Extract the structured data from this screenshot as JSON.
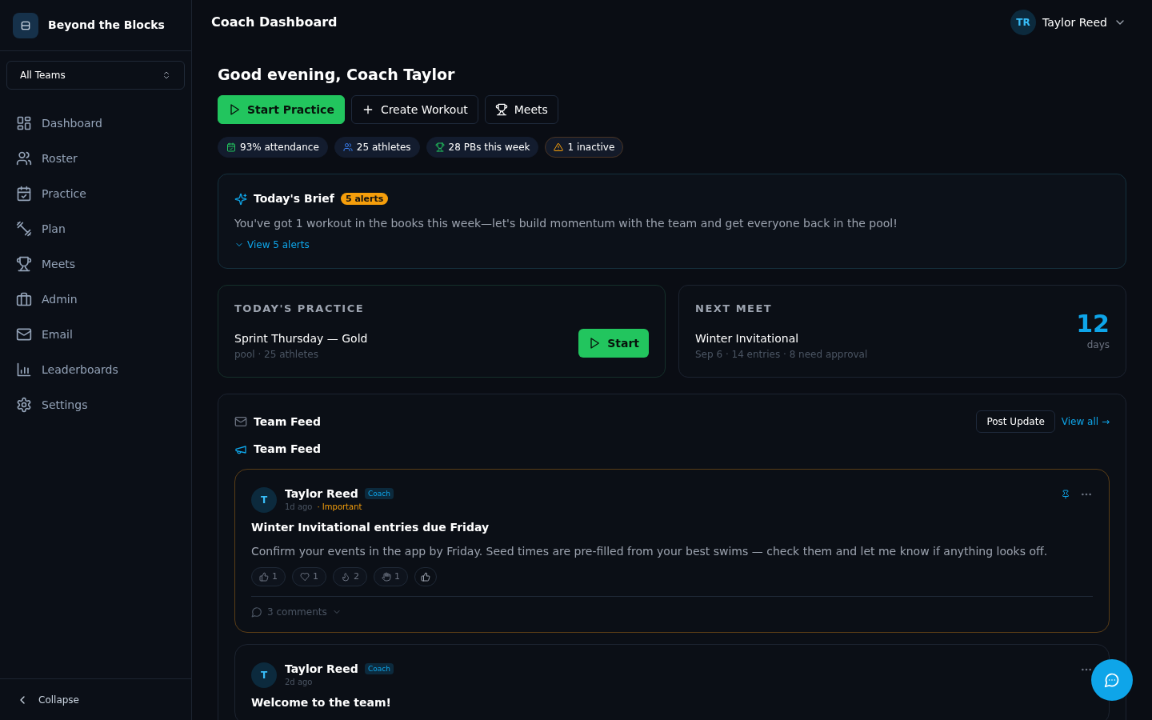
{
  "sidebar": {
    "brand": "Beyond the Blocks",
    "team_selector": "All Teams",
    "items": [
      {
        "label": "Dashboard",
        "kind": "dashboard",
        "selected": false
      },
      {
        "label": "Roster",
        "kind": "roster",
        "selected": false
      },
      {
        "label": "Practice",
        "kind": "practice",
        "selected": false
      },
      {
        "label": "Plan",
        "kind": "plan",
        "selected": false
      },
      {
        "label": "Meets",
        "kind": "meets",
        "selected": false
      },
      {
        "label": "Admin",
        "kind": "admin",
        "selected": false
      },
      {
        "label": "Email",
        "kind": "email",
        "selected": false
      },
      {
        "label": "Leaderboards",
        "kind": "leaderboards",
        "selected": false
      },
      {
        "label": "Settings",
        "kind": "settings",
        "selected": false
      }
    ],
    "collapse": "Collapse"
  },
  "header": {
    "title": "Coach Dashboard",
    "user": {
      "initials": "TR",
      "name": "Taylor Reed"
    }
  },
  "greeting": "Good evening, Coach Taylor",
  "actions": [
    {
      "label": "Start Practice",
      "kind": "start"
    },
    {
      "label": "Create Workout",
      "kind": "create"
    },
    {
      "label": "Meets",
      "kind": "meets"
    }
  ],
  "stats": [
    {
      "label": "93% attendance",
      "kind": "attendance"
    },
    {
      "label": "25 athletes",
      "kind": "athletes"
    },
    {
      "label": "28 PBs this week",
      "kind": "pbs"
    },
    {
      "label": "1 inactive",
      "kind": "inactive"
    }
  ],
  "brief": {
    "title": "Today's Brief",
    "badge": "5 alerts",
    "text": "You've got 1 workout in the books this week—let's build momentum with the team and get everyone back in the pool!",
    "link": "View 5 alerts",
    "expanded": false
  },
  "todays_practice": {
    "heading": "TODAY'S PRACTICE",
    "name": "Sprint Thursday — Gold",
    "meta": "pool · 25 athletes",
    "button": "Start"
  },
  "next_meet": {
    "heading": "NEXT MEET",
    "name": "Winter Invitational",
    "meta": "Sep 6 · 14 entries · 8 need approval",
    "count": "12",
    "unit": "days"
  },
  "feed": {
    "title": "Team Feed",
    "subtitle": "Team Feed",
    "post_button": "Post Update",
    "view_all": "View all →",
    "posts": [
      {
        "avatar": "T",
        "author": "Taylor Reed",
        "role": "Coach",
        "time": "1d ago",
        "tag": "· Important",
        "important": true,
        "pinned": true,
        "title": "Winter Invitational entries due Friday",
        "body": "Confirm your events in the app by Friday. Seed times are pre-filled from your best swims — check them and let me know if anything looks off.",
        "reactions": [
          {
            "kind": "thumbs",
            "count": "1"
          },
          {
            "kind": "heart",
            "count": "1"
          },
          {
            "kind": "fire",
            "count": "2"
          },
          {
            "kind": "clap",
            "count": "1"
          },
          {
            "kind": "add"
          }
        ],
        "comments": "3 comments"
      },
      {
        "avatar": "T",
        "author": "Taylor Reed",
        "role": "Coach",
        "time": "2d ago",
        "important": false,
        "pinned": false,
        "title": "Welcome to the team!"
      }
    ]
  }
}
